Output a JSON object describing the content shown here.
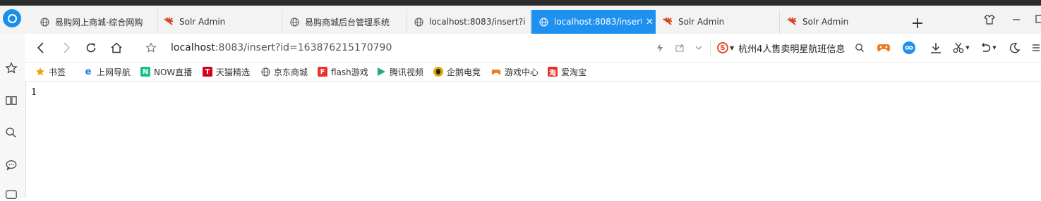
{
  "tabs": [
    {
      "label": "易购网上商城-综合网购",
      "icon": "globe-icon"
    },
    {
      "label": "Solr Admin",
      "icon": "solr-icon"
    },
    {
      "label": "易购商城后台管理系统",
      "icon": "globe-icon"
    },
    {
      "label": "localhost:8083/insert?i",
      "icon": "globe-icon"
    },
    {
      "label": "localhost:8083/insert",
      "icon": "globe-icon",
      "active": true
    },
    {
      "label": "Solr Admin",
      "icon": "solr-icon"
    },
    {
      "label": "Solr Admin",
      "icon": "solr-icon"
    }
  ],
  "address": {
    "host": "localhost",
    "rest": ":8083/insert?id=163876215170790"
  },
  "search": {
    "query": "杭州4人售卖明星航班信息"
  },
  "bookmarks": [
    {
      "label": "书签",
      "icon": "star-icon"
    },
    {
      "label": "上网导航",
      "icon": "ie-icon"
    },
    {
      "label": "NOW直播",
      "icon": "now-icon"
    },
    {
      "label": "天猫精选",
      "icon": "tmall-icon"
    },
    {
      "label": "京东商城",
      "icon": "globe-icon"
    },
    {
      "label": "flash游戏",
      "icon": "flash-icon"
    },
    {
      "label": "腾讯视频",
      "icon": "video-icon"
    },
    {
      "label": "企鹅电竞",
      "icon": "penguin-icon"
    },
    {
      "label": "游戏中心",
      "icon": "gamepad-icon"
    },
    {
      "label": "爱淘宝",
      "icon": "taobao-icon"
    }
  ],
  "page": {
    "body_text": "1"
  },
  "colors": {
    "accent": "#1e90f0",
    "topstrip": "#2b2b2b"
  }
}
